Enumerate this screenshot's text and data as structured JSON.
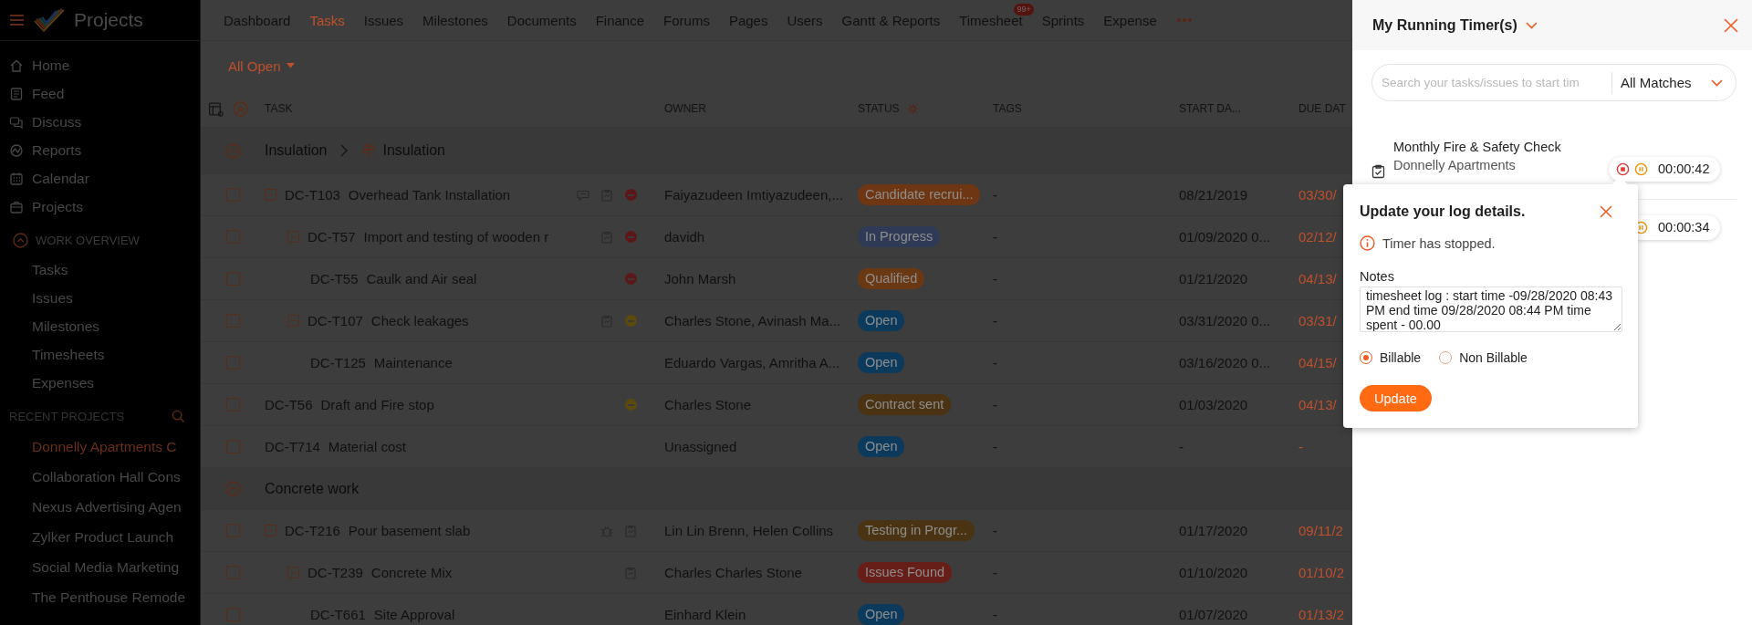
{
  "sidebar": {
    "title": "Projects",
    "nav": [
      "Home",
      "Feed",
      "Discuss",
      "Reports",
      "Calendar",
      "Projects"
    ],
    "work_overview": {
      "title": "WORK OVERVIEW",
      "expanded": true,
      "items": [
        "Tasks",
        "Issues",
        "Milestones",
        "Timesheets",
        "Expenses"
      ]
    },
    "recent_projects": {
      "title": "RECENT PROJECTS",
      "items": [
        {
          "label": "Donnelly Apartments C",
          "selected": true
        },
        {
          "label": "Collaboration Hall Cons",
          "selected": false
        },
        {
          "label": "Nexus Advertising Agen",
          "selected": false
        },
        {
          "label": "Zylker Product Launch",
          "selected": false
        },
        {
          "label": "Social Media Marketing",
          "selected": false
        },
        {
          "label": "The Penthouse Remode",
          "selected": false
        }
      ]
    }
  },
  "nav": {
    "tabs": [
      {
        "label": "Dashboard",
        "selected": false
      },
      {
        "label": "Tasks",
        "selected": true
      },
      {
        "label": "Issues",
        "selected": false
      },
      {
        "label": "Milestones",
        "selected": false
      },
      {
        "label": "Documents",
        "selected": false
      },
      {
        "label": "Finance",
        "selected": false
      },
      {
        "label": "Forums",
        "selected": false
      },
      {
        "label": "Pages",
        "selected": false
      },
      {
        "label": "Users",
        "selected": false
      },
      {
        "label": "Gantt & Reports",
        "selected": false
      },
      {
        "label": "Timesheet",
        "selected": false,
        "badge": "99+"
      },
      {
        "label": "Sprints",
        "selected": false
      },
      {
        "label": "Expense",
        "selected": false
      }
    ]
  },
  "filter": {
    "label": "All Open"
  },
  "table": {
    "columns": [
      "TASK",
      "OWNER",
      "STATUS",
      "TAGS",
      "START DA...",
      "DUE DAT"
    ],
    "groups": [
      {
        "name": "Insulation",
        "milestone": "Insulation",
        "expanded": true,
        "tasks": [
          {
            "id": "DC-T103",
            "title": "Overhead Tank Installation",
            "checked": false,
            "comments": true,
            "timelog": true,
            "priority": {
              "color": "#5c1818"
            },
            "owner": "Faiyazudeen Imtiyazudeen,...",
            "status": {
              "label": "Candidate recrui...",
              "color": "#6e3612"
            },
            "tags": "-",
            "start_date": "08/21/2019",
            "due_date": "03/30/",
            "expanded": true,
            "children": [
              {
                "id": "DC-T57",
                "title": "Import and testing of wooden r",
                "checked": false,
                "timelog": true,
                "priority": {
                  "color": "#5c1818"
                },
                "owner": "davidh",
                "status": {
                  "label": "In Progress",
                  "color": "#2f3a56"
                },
                "tags": "-",
                "start_date": "01/09/2020 0...",
                "due_date": "02/12/",
                "expanded": true,
                "children": [
                  {
                    "id": "DC-T55",
                    "title": "Caulk and Air seal",
                    "checked": false,
                    "priority": {
                      "color": "#5c1818"
                    },
                    "owner": "John Marsh",
                    "status": {
                      "label": "Qualified",
                      "color": "#6b3814"
                    },
                    "tags": "-",
                    "start_date": "01/21/2020",
                    "due_date": "04/13/"
                  }
                ]
              },
              {
                "id": "DC-T107",
                "title": "Check leakages",
                "checked": false,
                "timelog": true,
                "priority": {
                  "color": "#5c4a0c"
                },
                "owner": "Charles Stone, Avinash Ma...",
                "status": {
                  "label": "Open",
                  "color": "#0b3a5c"
                },
                "tags": "-",
                "start_date": "03/31/2020 0...",
                "due_date": "03/31/",
                "expanded": true,
                "children": [
                  {
                    "id": "DC-T125",
                    "title": "Maintenance",
                    "checked": false,
                    "owner": "Eduardo Vargas, Amritha A...",
                    "status": {
                      "label": "Open",
                      "color": "#0b3a5c"
                    },
                    "tags": "-",
                    "start_date": "03/16/2020 0...",
                    "due_date": "04/15/"
                  }
                ]
              }
            ]
          },
          {
            "id": "DC-T56",
            "title": "Draft and Fire stop",
            "checked": false,
            "priority": {
              "color": "#5c4a0c"
            },
            "owner": "Charles Stone",
            "status": {
              "label": "Contract sent",
              "color": "#4a3213"
            },
            "tags": "-",
            "start_date": "01/03/2020",
            "due_date": "04/13/"
          },
          {
            "id": "DC-T714",
            "title": "Material cost",
            "checked": false,
            "owner": "Unassigned",
            "status": {
              "label": "Open",
              "color": "#0b3a5c"
            },
            "tags": "-",
            "start_date": "-",
            "due_date": "-"
          }
        ]
      },
      {
        "name": "Concrete work",
        "expanded": true,
        "tasks": [
          {
            "id": "DC-T216",
            "title": "Pour basement slab",
            "checked": false,
            "bug": true,
            "timelog": true,
            "owner": "Lin Lin Brenn, Helen Collins",
            "status": {
              "label": "Testing in Progr...",
              "color": "#4a3312"
            },
            "tags": "-",
            "start_date": "01/17/2020",
            "due_date": "09/11/2",
            "expanded": true,
            "children": [
              {
                "id": "DC-T239",
                "title": "Concrete Mix",
                "checked": false,
                "timelog": true,
                "owner": "Charles Charles Stone",
                "status": {
                  "label": "Issues Found",
                  "color": "#681e18"
                },
                "tags": "-",
                "start_date": "01/10/2020",
                "due_date": "01/10/2",
                "expanded": true,
                "children": [
                  {
                    "id": "DC-T661",
                    "title": "Site Approval",
                    "checked": false,
                    "owner": "Einhard Klein",
                    "status": {
                      "label": "Open",
                      "color": "#0b3a5c"
                    },
                    "tags": "-",
                    "start_date": "01/07/2020",
                    "due_date": "01/13/2"
                  }
                ]
              }
            ]
          }
        ]
      }
    ]
  },
  "timer_panel": {
    "title": "My Running Timer(s)",
    "search": {
      "placeholder": "Search your tasks/issues to start tim"
    },
    "match_filter": "All Matches",
    "timers": [
      {
        "title": "Monthly Fire & Safety Check",
        "project": "Donnelly Apartments",
        "elapsed": "00:00:42"
      },
      {
        "elapsed": "00:00:34"
      }
    ]
  },
  "log_popup": {
    "title": "Update your log details.",
    "message": "Timer has stopped.",
    "notes_label": "Notes",
    "notes": "timesheet log : start time -09/28/2020 08:43 PM end time 09/28/2020 08:44 PM time spent - 00.00",
    "billing": [
      {
        "label": "Billable",
        "selected": true
      },
      {
        "label": "Non Billable",
        "selected": false
      }
    ],
    "button": "Update"
  }
}
